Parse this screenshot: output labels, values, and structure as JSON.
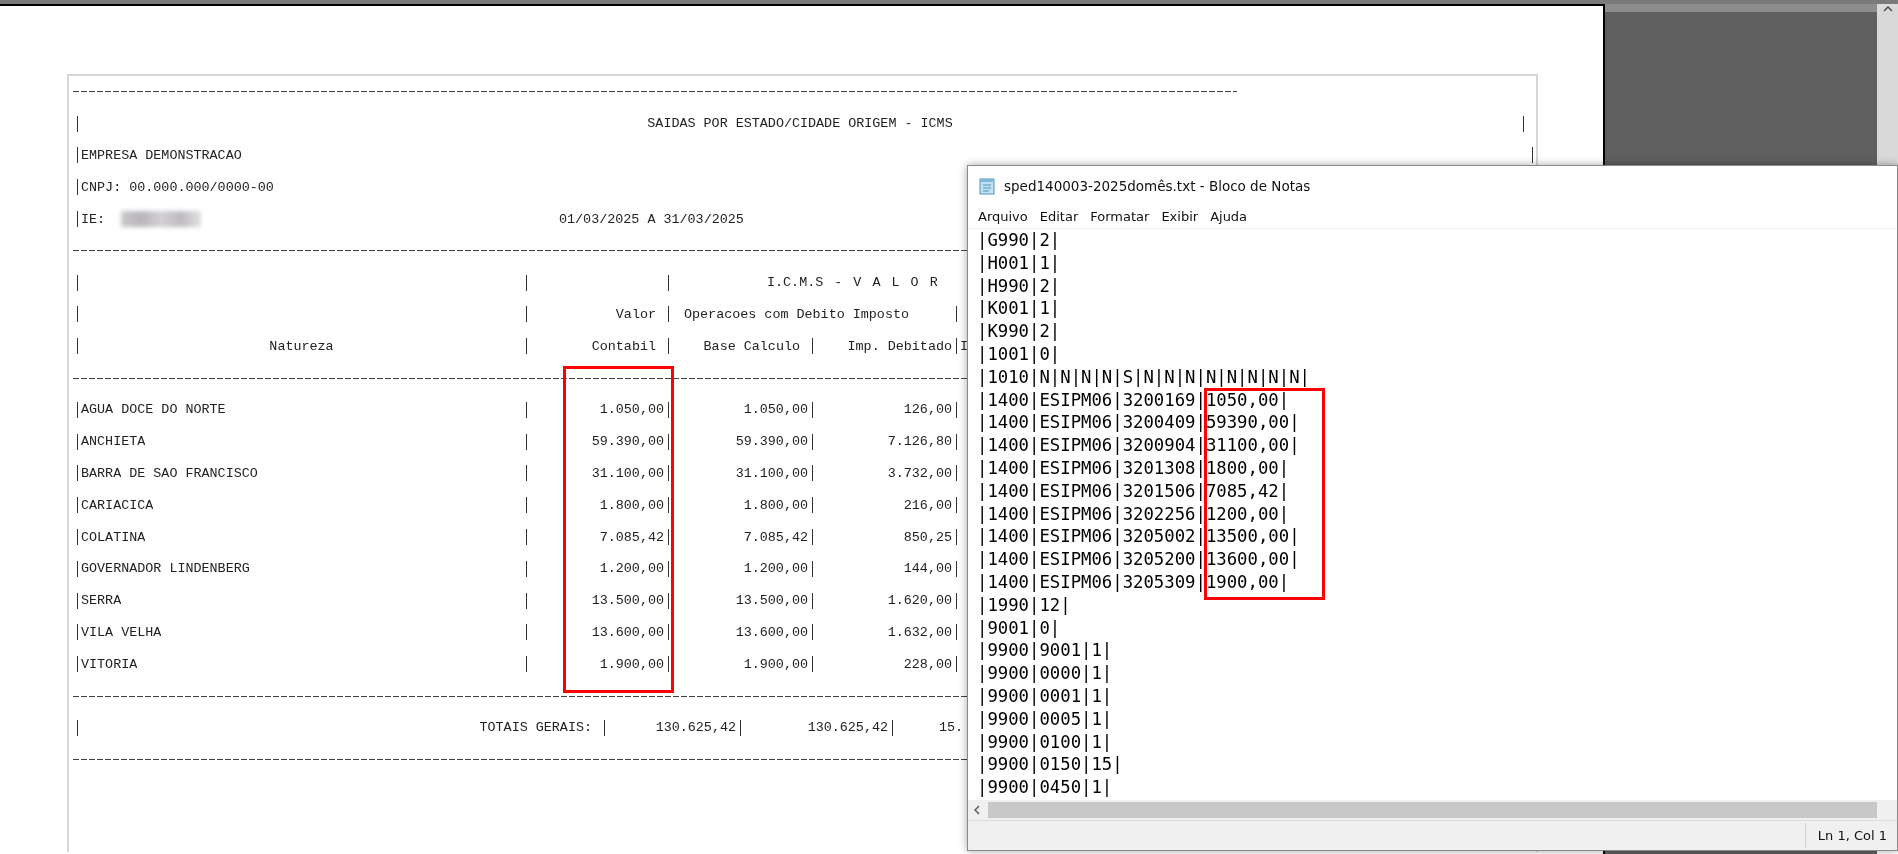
{
  "report": {
    "title": "SAIDAS POR ESTADO/CIDADE ORIGEM - ICMS",
    "company": "EMPRESA DEMONSTRACAO",
    "cnpj": "CNPJ: 00.000.000/0000-00",
    "ie_label": "IE:",
    "period": "01/03/2025 A 31/03/2025",
    "header": {
      "group": "I.C.M.S - V A L O R",
      "valor": "Valor",
      "operacoes": "Operacoes com Debito Imposto",
      "natureza": "Natureza",
      "contabil": "Contabil",
      "base": "Base Calculo",
      "imp": "Imp. Debitado",
      "column_5": "I"
    },
    "rows": [
      {
        "natureza": "AGUA DOCE DO NORTE",
        "valor_contabil": "1.050,00",
        "base_calculo": "1.050,00",
        "imp_debitado": "126,00"
      },
      {
        "natureza": "ANCHIETA",
        "valor_contabil": "59.390,00",
        "base_calculo": "59.390,00",
        "imp_debitado": "7.126,80"
      },
      {
        "natureza": "BARRA DE SAO FRANCISCO",
        "valor_contabil": "31.100,00",
        "base_calculo": "31.100,00",
        "imp_debitado": "3.732,00"
      },
      {
        "natureza": "CARIACICA",
        "valor_contabil": "1.800,00",
        "base_calculo": "1.800,00",
        "imp_debitado": "216,00"
      },
      {
        "natureza": "COLATINA",
        "valor_contabil": "7.085,42",
        "base_calculo": "7.085,42",
        "imp_debitado": "850,25"
      },
      {
        "natureza": "GOVERNADOR LINDENBERG",
        "valor_contabil": "1.200,00",
        "base_calculo": "1.200,00",
        "imp_debitado": "144,00"
      },
      {
        "natureza": "SERRA",
        "valor_contabil": "13.500,00",
        "base_calculo": "13.500,00",
        "imp_debitado": "1.620,00"
      },
      {
        "natureza": "VILA VELHA",
        "valor_contabil": "13.600,00",
        "base_calculo": "13.600,00",
        "imp_debitado": "1.632,00"
      },
      {
        "natureza": "VITORIA",
        "valor_contabil": "1.900,00",
        "base_calculo": "1.900,00",
        "imp_debitado": "228,00"
      }
    ],
    "totals": {
      "label": "TOTAIS GERAIS:",
      "valor_contabil": "130.625,42",
      "base_calculo": "130.625,42",
      "column_5": "15."
    }
  },
  "notepad": {
    "title": "sped140003-2025domês.txt - Bloco de Notas",
    "menu": [
      "Arquivo",
      "Editar",
      "Formatar",
      "Exibir",
      "Ajuda"
    ],
    "lines": [
      "|G990|2|",
      "|H001|1|",
      "|H990|2|",
      "|K001|1|",
      "|K990|2|",
      "|1001|0|",
      "|1010|N|N|N|N|S|N|N|N|N|N|N|N|N|",
      "|1400|ESIPM06|3200169|1050,00|",
      "|1400|ESIPM06|3200409|59390,00|",
      "|1400|ESIPM06|3200904|31100,00|",
      "|1400|ESIPM06|3201308|1800,00|",
      "|1400|ESIPM06|3201506|7085,42|",
      "|1400|ESIPM06|3202256|1200,00|",
      "|1400|ESIPM06|3205002|13500,00|",
      "|1400|ESIPM06|3205200|13600,00|",
      "|1400|ESIPM06|3205309|1900,00|",
      "|1990|12|",
      "|9001|0|",
      "|9900|9001|1|",
      "|9900|0000|1|",
      "|9900|0001|1|",
      "|9900|0005|1|",
      "|9900|0100|1|",
      "|9900|0150|15|",
      "|9900|0450|1|"
    ],
    "status": "Ln 1, Col 1"
  }
}
